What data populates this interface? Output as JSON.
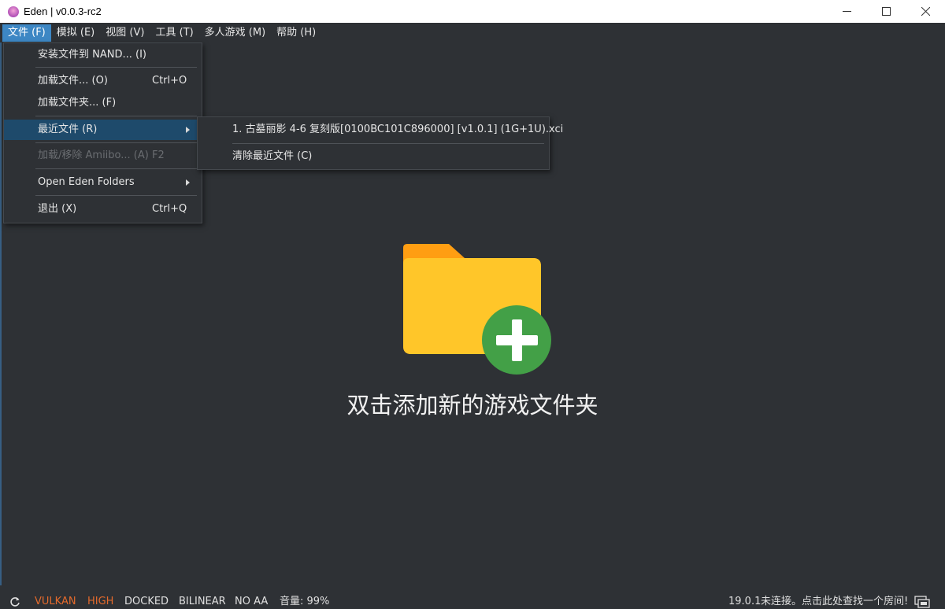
{
  "window": {
    "title": "Eden | v0.0.3-rc2",
    "icons": [
      "app-icon",
      "minimize-icon",
      "maximize-icon",
      "close-icon"
    ]
  },
  "menubar": {
    "items": [
      {
        "label": "文件 (F)",
        "active": true
      },
      {
        "label": "模拟 (E)"
      },
      {
        "label": "视图 (V)"
      },
      {
        "label": "工具 (T)"
      },
      {
        "label": "多人游戏 (M)"
      },
      {
        "label": "帮助 (H)"
      }
    ]
  },
  "file_menu": {
    "install_nand": "安装文件到 NAND... (I)",
    "load_file": "加载文件... (O)",
    "load_file_shortcut": "Ctrl+O",
    "load_folder": "加载文件夹... (F)",
    "recent_files": "最近文件 (R)",
    "amiibo": "加载/移除 Amiibo... (A)",
    "amiibo_shortcut": "F2",
    "open_folders": "Open Eden Folders",
    "exit": "退出 (X)",
    "exit_shortcut": "Ctrl+Q"
  },
  "recent_submenu": {
    "item1": "1. 古墓丽影 4-6 复刻版[0100BC101C896000] [v1.0.1] (1G+1U).xci",
    "clear": "清除最近文件 (C)"
  },
  "main": {
    "add_folder_prompt": "双击添加新的游戏文件夹",
    "colors": {
      "folder": "#ffc629",
      "folder_tab": "#ff9e12",
      "plus_circle": "#43a047"
    }
  },
  "statusbar": {
    "api": "VULKAN",
    "accuracy": "HIGH",
    "mode": "DOCKED",
    "filter": "BILINEAR",
    "aa": "NO AA",
    "volume": "音量: 99%",
    "version": "19.0.1",
    "network": "未连接。点击此处查找一个房间!",
    "accent_color": "#e46a2c"
  }
}
